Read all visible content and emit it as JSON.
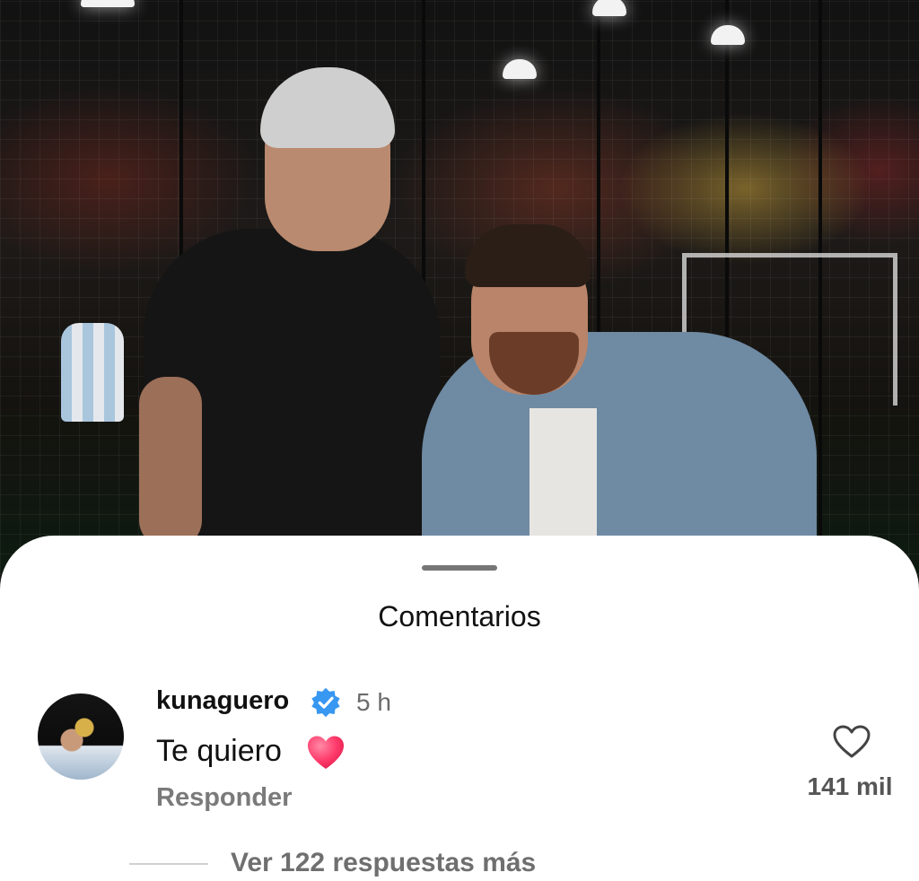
{
  "sheet": {
    "title": "Comentarios"
  },
  "comment": {
    "username": "kunaguero",
    "verified": true,
    "time": "5 h",
    "text": "Te quiero",
    "emoji": "heart-emoji",
    "reply_label": "Responder",
    "like_count": "141 mil"
  },
  "replies": {
    "label": "Ver 122 respuestas más"
  },
  "colors": {
    "verified_blue": "#3897f0",
    "heart_pink": "#ff3b6b",
    "secondary_text": "#7a7a7a"
  }
}
